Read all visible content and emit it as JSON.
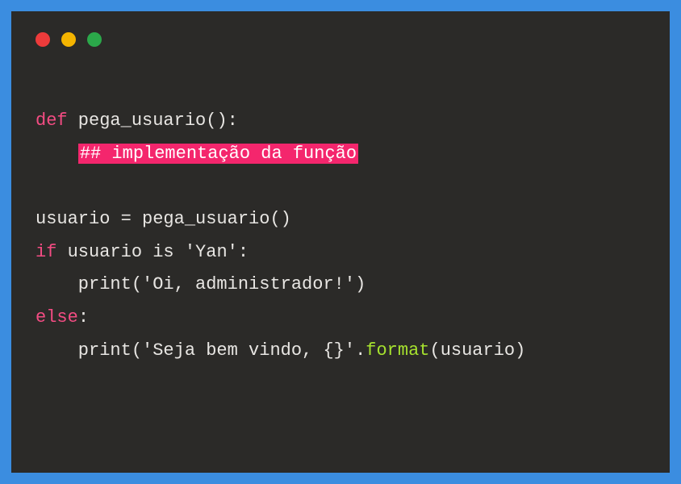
{
  "code": {
    "line1": {
      "kw": "def",
      "rest": " pega_usuario():"
    },
    "line2": {
      "indent": "    ",
      "comment": "## implementação da função"
    },
    "line3": "",
    "line4": "usuario = pega_usuario()",
    "line5": {
      "kw": "if",
      "rest": " usuario is 'Yan':"
    },
    "line6": "    print('Oi, administrador!')",
    "line7": {
      "kw": "else",
      "rest": ":"
    },
    "line8": {
      "part1": "    print('Seja bem vindo, {}'.",
      "method": "format",
      "part2": "(usuario)"
    }
  }
}
